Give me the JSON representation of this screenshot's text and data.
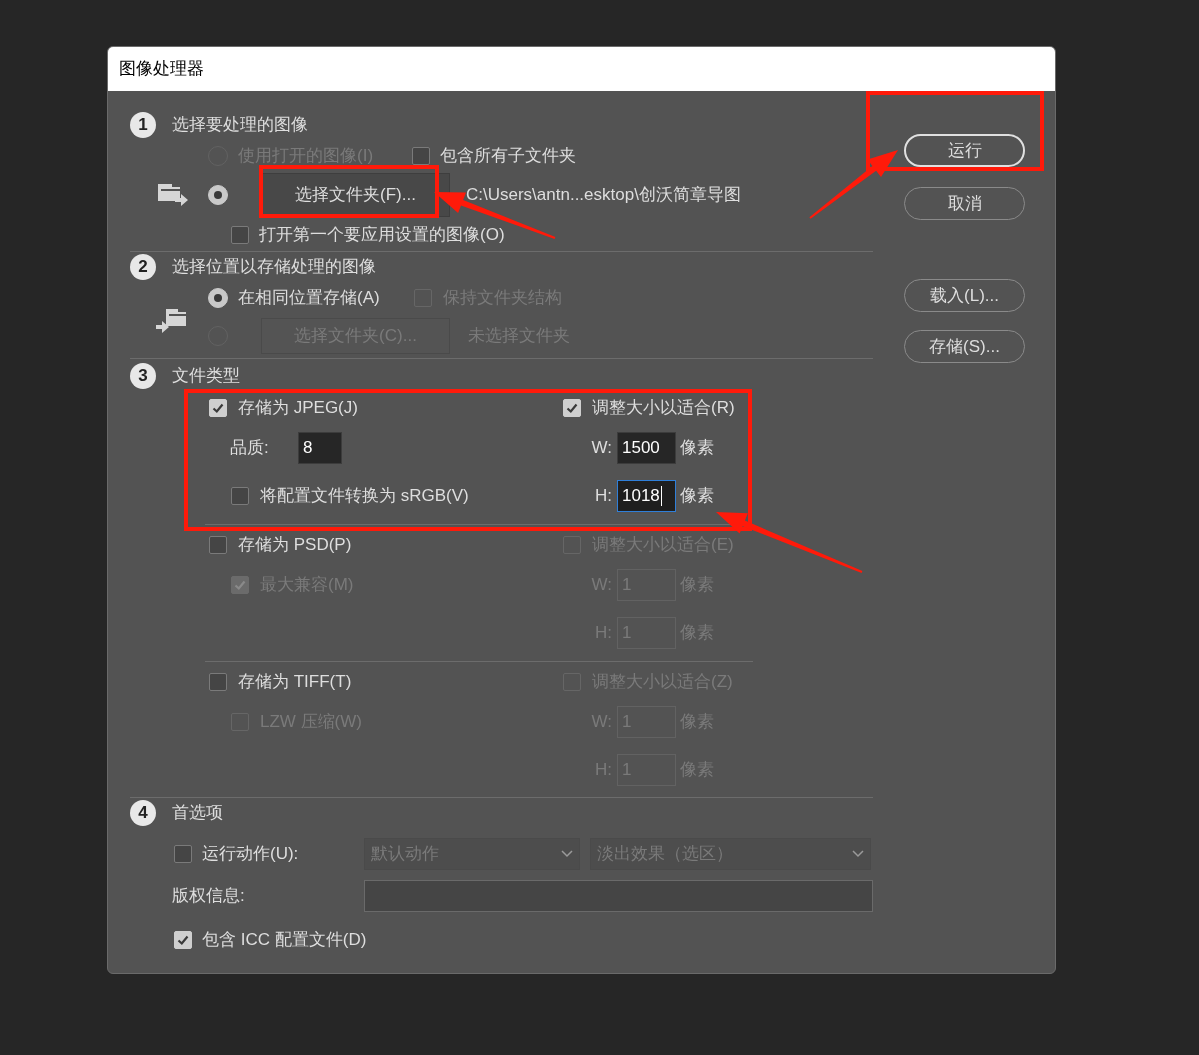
{
  "window": {
    "title": "图像处理器"
  },
  "sections": [
    {
      "number": "1",
      "title": "选择要处理的图像"
    },
    {
      "number": "2",
      "title": "选择位置以存储处理的图像"
    },
    {
      "number": "3",
      "title": "文件类型"
    },
    {
      "number": "4",
      "title": "首选项"
    }
  ],
  "source": {
    "options": [
      {
        "label": "使用打开的图像(I)",
        "selected": false,
        "disabled": true
      },
      {
        "button": "选择文件夹(F)...",
        "path": "C:\\Users\\antn...esktop\\创沃简章导图",
        "selected": true,
        "disabled": false
      }
    ],
    "include_subfolders": {
      "label": "包含所有子文件夹",
      "checked": false,
      "disabled": false
    },
    "open_first": {
      "label": "打开第一个要应用设置的图像(O)",
      "checked": false,
      "disabled": false
    }
  },
  "destination": {
    "options": [
      {
        "label": "在相同位置存储(A)",
        "selected": true,
        "disabled": false
      },
      {
        "button": "选择文件夹(C)...",
        "path": "未选择文件夹",
        "selected": false,
        "disabled": true
      }
    ],
    "keep_structure": {
      "label": "保持文件夹结构",
      "checked": false,
      "disabled": true
    }
  },
  "file_types": [
    {
      "save": {
        "label": "存储为 JPEG(J)",
        "checked": true
      },
      "resize": {
        "label": "调整大小以适合(R)",
        "checked": true,
        "disabled": false
      },
      "width": {
        "label": "W:",
        "value": "1500",
        "unit": "像素",
        "disabled": false,
        "focused": false
      },
      "height": {
        "label": "H:",
        "value": "1018",
        "unit": "像素",
        "disabled": false,
        "focused": true
      },
      "options": [
        {
          "kind": "field",
          "label": "品质:",
          "value": "8"
        },
        {
          "kind": "checkbox",
          "label": "将配置文件转换为 sRGB(V)",
          "checked": false,
          "disabled": false
        }
      ]
    },
    {
      "save": {
        "label": "存储为 PSD(P)",
        "checked": false
      },
      "resize": {
        "label": "调整大小以适合(E)",
        "checked": false,
        "disabled": true
      },
      "width": {
        "label": "W:",
        "value": "1",
        "unit": "像素",
        "disabled": true,
        "focused": false
      },
      "height": {
        "label": "H:",
        "value": "1",
        "unit": "像素",
        "disabled": true,
        "focused": false
      },
      "options": [
        {
          "kind": "checkbox",
          "label": "最大兼容(M)",
          "checked": true,
          "disabled": true
        }
      ]
    },
    {
      "save": {
        "label": "存储为 TIFF(T)",
        "checked": false
      },
      "resize": {
        "label": "调整大小以适合(Z)",
        "checked": false,
        "disabled": true
      },
      "width": {
        "label": "W:",
        "value": "1",
        "unit": "像素",
        "disabled": true,
        "focused": false
      },
      "height": {
        "label": "H:",
        "value": "1",
        "unit": "像素",
        "disabled": true,
        "focused": false
      },
      "options": [
        {
          "kind": "checkbox",
          "label": "LZW 压缩(W)",
          "checked": false,
          "disabled": true
        }
      ]
    }
  ],
  "preferences": {
    "run_action": {
      "label": "运行动作(U):",
      "checked": false,
      "set": "默认动作",
      "action": "淡出效果（选区）",
      "disabled": true
    },
    "copyright": {
      "label": "版权信息:"
    },
    "include_icc": {
      "label": "包含 ICC 配置文件(D)",
      "checked": true,
      "disabled": false
    }
  },
  "buttons": [
    {
      "label": "运行",
      "default": true
    },
    {
      "label": "取消",
      "default": false
    },
    {
      "label": "载入(L)...",
      "default": false
    },
    {
      "label": "存储(S)...",
      "default": false
    }
  ]
}
